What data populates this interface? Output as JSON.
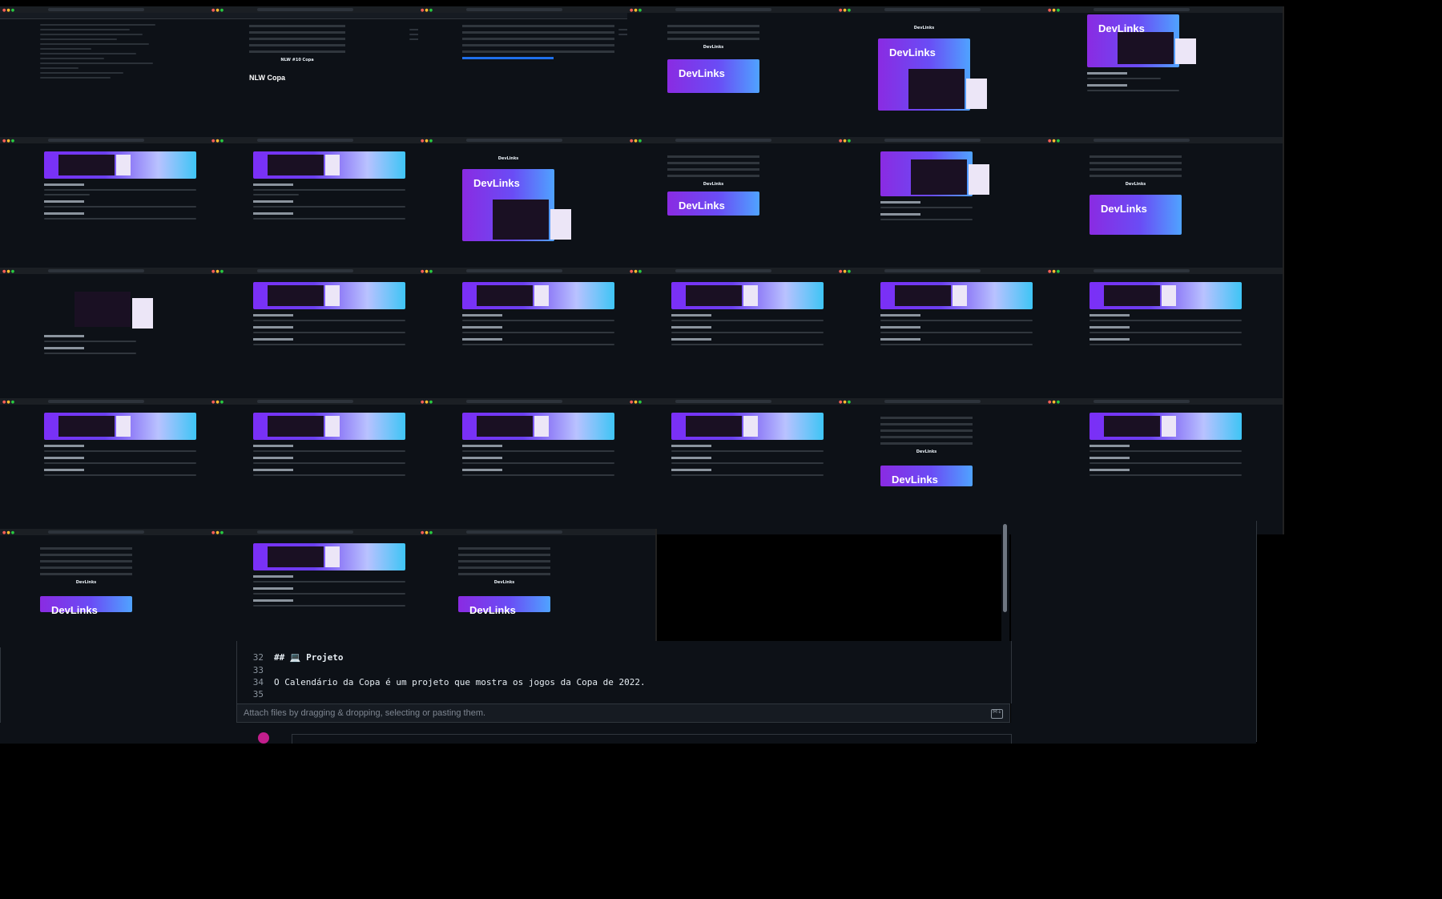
{
  "editor": {
    "lines": [
      {
        "n": "32",
        "text": "## 💻 Projeto"
      },
      {
        "n": "33",
        "text": ""
      },
      {
        "n": "34",
        "text": "O Calendário da Copa é um projeto que mostra os jogos da Copa de 2022."
      },
      {
        "n": "35",
        "text": ""
      }
    ],
    "attach_hint": "Attach files by dragging & dropping, selecting or pasting them."
  },
  "thumbnails": {
    "banner_title": "DevLinks",
    "nlw_title": "NLW Copa",
    "nlw_subtitle": "NLW #10 Copa",
    "devlinks_heading": "DevLinks"
  },
  "colors": {
    "banner_gradient_start": "#7b2ff7",
    "banner_gradient_end": "#3ec5f5",
    "background": "#0d1117"
  },
  "icons": [
    "markdown-icon",
    "avatar"
  ]
}
